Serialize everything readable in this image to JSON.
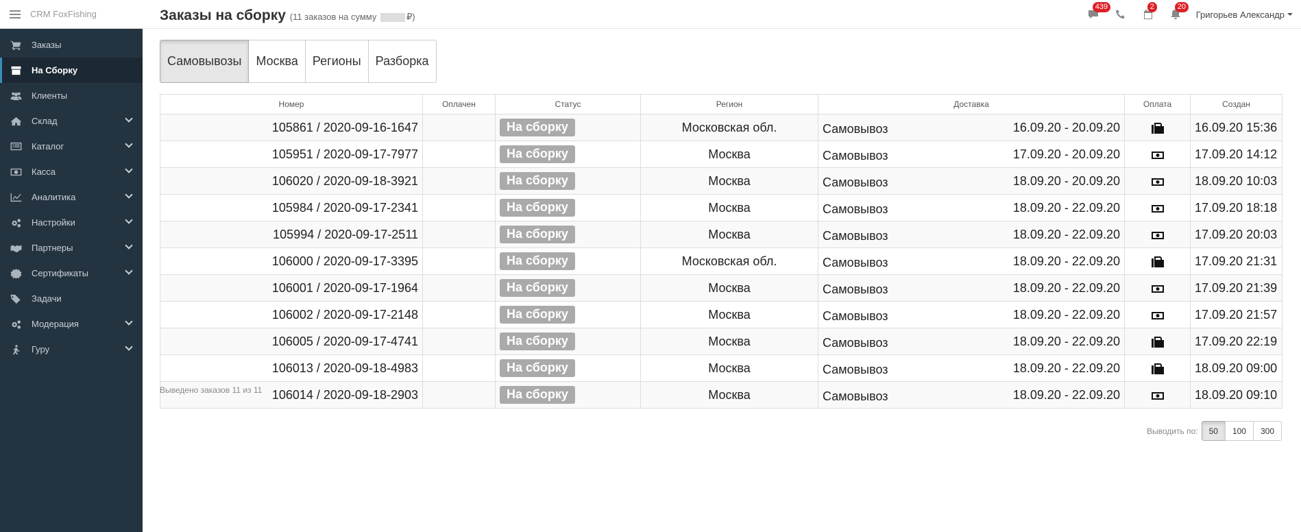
{
  "brand": {
    "name": "CRM FoxFishing"
  },
  "sidebar": {
    "items": [
      {
        "label": "Заказы",
        "icon": "cart-icon",
        "chevron": false,
        "active": false
      },
      {
        "label": "На Сборку",
        "icon": "box-icon",
        "chevron": false,
        "active": true
      },
      {
        "label": "Клиенты",
        "icon": "users-icon",
        "chevron": false,
        "active": false
      },
      {
        "label": "Склад",
        "icon": "home-icon",
        "chevron": true,
        "active": false
      },
      {
        "label": "Каталог",
        "icon": "list-icon",
        "chevron": true,
        "active": false
      },
      {
        "label": "Касса",
        "icon": "money-icon",
        "chevron": true,
        "active": false
      },
      {
        "label": "Аналитика",
        "icon": "line-chart-icon",
        "chevron": true,
        "active": false
      },
      {
        "label": "Настройки",
        "icon": "gears-icon",
        "chevron": true,
        "active": false
      },
      {
        "label": "Партнеры",
        "icon": "handshake-icon",
        "chevron": true,
        "active": false
      },
      {
        "label": "Сертификаты",
        "icon": "certificate-icon",
        "chevron": true,
        "active": false
      },
      {
        "label": "Задачи",
        "icon": "tags-icon",
        "chevron": false,
        "active": false
      },
      {
        "label": "Модерация",
        "icon": "gears-icon",
        "chevron": true,
        "active": false
      },
      {
        "label": "Гуру",
        "icon": "walking-icon",
        "chevron": true,
        "active": false
      }
    ]
  },
  "header": {
    "title": "Заказы на сборку",
    "subtitle_prefix": "(11 заказов на сумму",
    "subtitle_suffix": "₽)",
    "badges": {
      "messages": "439",
      "calendar": "2",
      "notifications": "20"
    },
    "user": "Григорьев Александр"
  },
  "tabs": [
    {
      "label": "Самовывозы",
      "active": true
    },
    {
      "label": "Москва",
      "active": false
    },
    {
      "label": "Регионы",
      "active": false
    },
    {
      "label": "Разборка",
      "active": false
    }
  ],
  "table": {
    "headers": {
      "number": "Номер",
      "paid": "Оплачен",
      "status": "Статус",
      "region": "Регион",
      "delivery": "Доставка",
      "payment": "Оплата",
      "created": "Создан"
    },
    "rows": [
      {
        "number": "105861 / 2020-09-16-1647",
        "paid": "",
        "status": "На сборку",
        "region": "Московская обл.",
        "delivery_type": "Самовывоз",
        "delivery_dates": "16.09.20 - 20.09.20",
        "payment_icon": "fax-icon",
        "created": "16.09.20 15:36"
      },
      {
        "number": "105951 / 2020-09-17-7977",
        "paid": "",
        "status": "На сборку",
        "region": "Москва",
        "delivery_type": "Самовывоз",
        "delivery_dates": "17.09.20 - 20.09.20",
        "payment_icon": "money-icon",
        "created": "17.09.20 14:12"
      },
      {
        "number": "106020 / 2020-09-18-3921",
        "paid": "",
        "status": "На сборку",
        "region": "Москва",
        "delivery_type": "Самовывоз",
        "delivery_dates": "18.09.20 - 20.09.20",
        "payment_icon": "money-icon",
        "created": "18.09.20 10:03"
      },
      {
        "number": "105984 / 2020-09-17-2341",
        "paid": "",
        "status": "На сборку",
        "region": "Москва",
        "delivery_type": "Самовывоз",
        "delivery_dates": "18.09.20 - 22.09.20",
        "payment_icon": "money-icon",
        "created": "17.09.20 18:18"
      },
      {
        "number": "105994 / 2020-09-17-2511",
        "paid": "",
        "status": "На сборку",
        "region": "Москва",
        "delivery_type": "Самовывоз",
        "delivery_dates": "18.09.20 - 22.09.20",
        "payment_icon": "money-icon",
        "created": "17.09.20 20:03"
      },
      {
        "number": "106000 / 2020-09-17-3395",
        "paid": "",
        "status": "На сборку",
        "region": "Московская обл.",
        "delivery_type": "Самовывоз",
        "delivery_dates": "18.09.20 - 22.09.20",
        "payment_icon": "fax-icon",
        "created": "17.09.20 21:31"
      },
      {
        "number": "106001 / 2020-09-17-1964",
        "paid": "",
        "status": "На сборку",
        "region": "Москва",
        "delivery_type": "Самовывоз",
        "delivery_dates": "18.09.20 - 22.09.20",
        "payment_icon": "money-icon",
        "created": "17.09.20 21:39"
      },
      {
        "number": "106002 / 2020-09-17-2148",
        "paid": "",
        "status": "На сборку",
        "region": "Москва",
        "delivery_type": "Самовывоз",
        "delivery_dates": "18.09.20 - 22.09.20",
        "payment_icon": "money-icon",
        "created": "17.09.20 21:57"
      },
      {
        "number": "106005 / 2020-09-17-4741",
        "paid": "",
        "status": "На сборку",
        "region": "Москва",
        "delivery_type": "Самовывоз",
        "delivery_dates": "18.09.20 - 22.09.20",
        "payment_icon": "fax-icon",
        "created": "17.09.20 22:19"
      },
      {
        "number": "106013 / 2020-09-18-4983",
        "paid": "",
        "status": "На сборку",
        "region": "Москва",
        "delivery_type": "Самовывоз",
        "delivery_dates": "18.09.20 - 22.09.20",
        "payment_icon": "fax-icon",
        "created": "18.09.20 09:00"
      },
      {
        "number": "106014 / 2020-09-18-2903",
        "paid": "",
        "status": "На сборку",
        "region": "Москва",
        "delivery_type": "Самовывоз",
        "delivery_dates": "18.09.20 - 22.09.20",
        "payment_icon": "money-icon",
        "created": "18.09.20 09:10"
      }
    ]
  },
  "footer": {
    "shown_text": "Выведено заказов 11 из 11",
    "per_page_label": "Выводить по:",
    "per_page_options": [
      "50",
      "100",
      "300"
    ],
    "per_page_selected": "50"
  },
  "colors": {
    "sidebar_bg": "#243340",
    "badge": "#dd1f26",
    "status_label": "#aaaaaa"
  }
}
